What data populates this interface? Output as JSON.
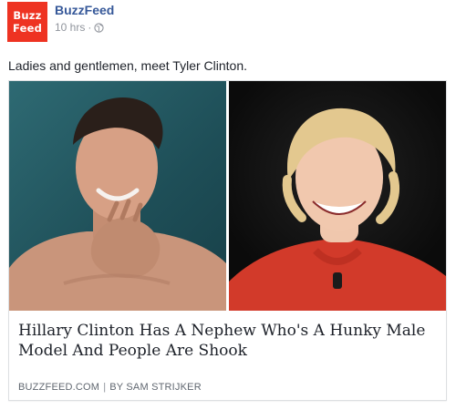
{
  "post": {
    "page_name": "BuzzFeed",
    "logo_line1": "Buzz",
    "logo_line2": "Feed",
    "timestamp": "10 hrs",
    "dot": "·",
    "privacy_icon": "globe-icon",
    "text": "Ladies and gentlemen, meet Tyler Clinton."
  },
  "card": {
    "headline": "Hillary Clinton Has A Nephew Who's A Hunky Male Model And People Are Shook",
    "domain": "BUZZFEED.COM",
    "separator": "|",
    "byline": "BY SAM STRIJKER"
  },
  "colors": {
    "brand": "#ee3322",
    "link": "#365899",
    "muted": "#90949c",
    "left_bg": "#1f4f58",
    "red_jacket": "#d23a2a"
  }
}
